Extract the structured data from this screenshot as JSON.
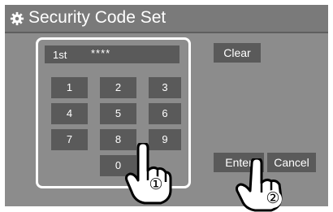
{
  "title": {
    "icon": "gear-icon",
    "text": "Security Code Set"
  },
  "keypad": {
    "position_label": "1st",
    "masked_code": "****",
    "keys": [
      "1",
      "2",
      "3",
      "4",
      "5",
      "6",
      "7",
      "8",
      "9",
      "0"
    ]
  },
  "buttons": {
    "clear": "Clear",
    "enter": "Enter",
    "cancel": "Cancel"
  },
  "callouts": {
    "step_1": "①",
    "step_2": "②"
  },
  "colors": {
    "screen_bg": "#8c8c8c",
    "title_bg": "#7a7a7a",
    "key_bg": "#5a5a5a",
    "text": "#ffffff"
  }
}
